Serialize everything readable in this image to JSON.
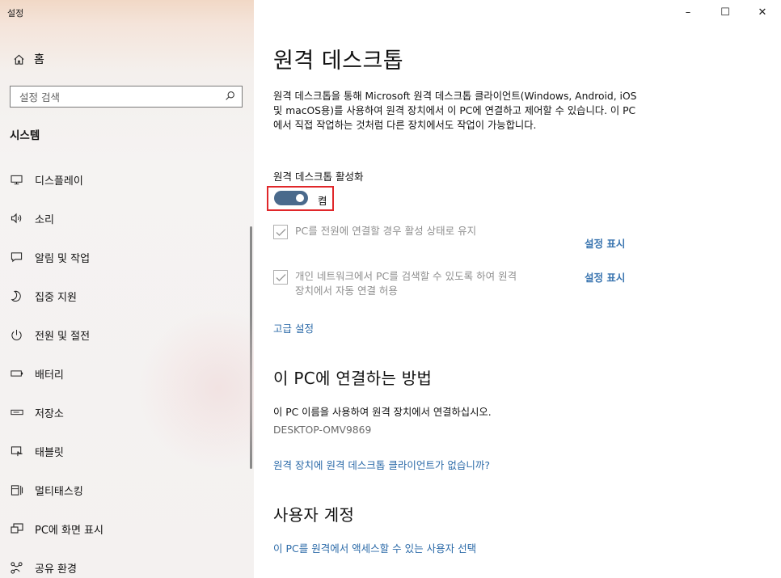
{
  "app": {
    "title": "설정"
  },
  "window": {
    "minimize": "–",
    "maximize": "☐",
    "close": "✕"
  },
  "sidebar": {
    "home_label": "홈",
    "search_placeholder": "설정 검색",
    "section_title": "시스템",
    "items": [
      {
        "label": "디스플레이",
        "icon": "monitor-icon"
      },
      {
        "label": "소리",
        "icon": "speaker-icon"
      },
      {
        "label": "알림 및 작업",
        "icon": "notification-icon"
      },
      {
        "label": "집중 지원",
        "icon": "moon-icon"
      },
      {
        "label": "전원 및 절전",
        "icon": "power-icon"
      },
      {
        "label": "배터리",
        "icon": "battery-icon"
      },
      {
        "label": "저장소",
        "icon": "storage-icon"
      },
      {
        "label": "태블릿",
        "icon": "tablet-icon"
      },
      {
        "label": "멀티태스킹",
        "icon": "multitasking-icon"
      },
      {
        "label": "PC에 화면 표시",
        "icon": "project-icon"
      },
      {
        "label": "공유 환경",
        "icon": "share-icon"
      }
    ]
  },
  "main": {
    "title": "원격 데스크톱",
    "description": "원격 데스크톱을 통해 Microsoft 원격 데스크톱 클라이언트(Windows, Android, iOS 및 macOS용)를 사용하여 원격 장치에서 이 PC에 연결하고 제어할 수 있습니다. 이 PC에서 직접 작업하는 것처럼 다른 장치에서도 작업이 가능합니다.",
    "enable_label": "원격 데스크톱 활성화",
    "toggle_state": "켬",
    "toggle_on": true,
    "option1": "PC를 전원에 연결할 경우 활성 상태로 유지",
    "option2_line1": "개인 네트워크에서 PC를 검색할 수 있도록 하여 원격",
    "option2_line2": "장치에서 자동 연결 허용",
    "show_settings_1": "설정 표시",
    "show_settings_2": "설정 표시",
    "advanced_link": "고급 설정",
    "connect_heading": "이 PC에 연결하는 방법",
    "connect_text": "이 PC 이름을 사용하여 원격 장치에서 연결하십시오.",
    "pc_name": "DESKTOP-OMV9869",
    "no_client_link": "원격 장치에 원격 데스크톱 클라이언트가 없습니까?",
    "accounts_heading": "사용자 계정",
    "select_users_link": "이 PC를 원격에서 액세스할 수 있는 사용자 선택"
  },
  "colors": {
    "accent": "#4a6a8c",
    "link": "#2b6aa8",
    "highlight_border": "#e0272a"
  }
}
